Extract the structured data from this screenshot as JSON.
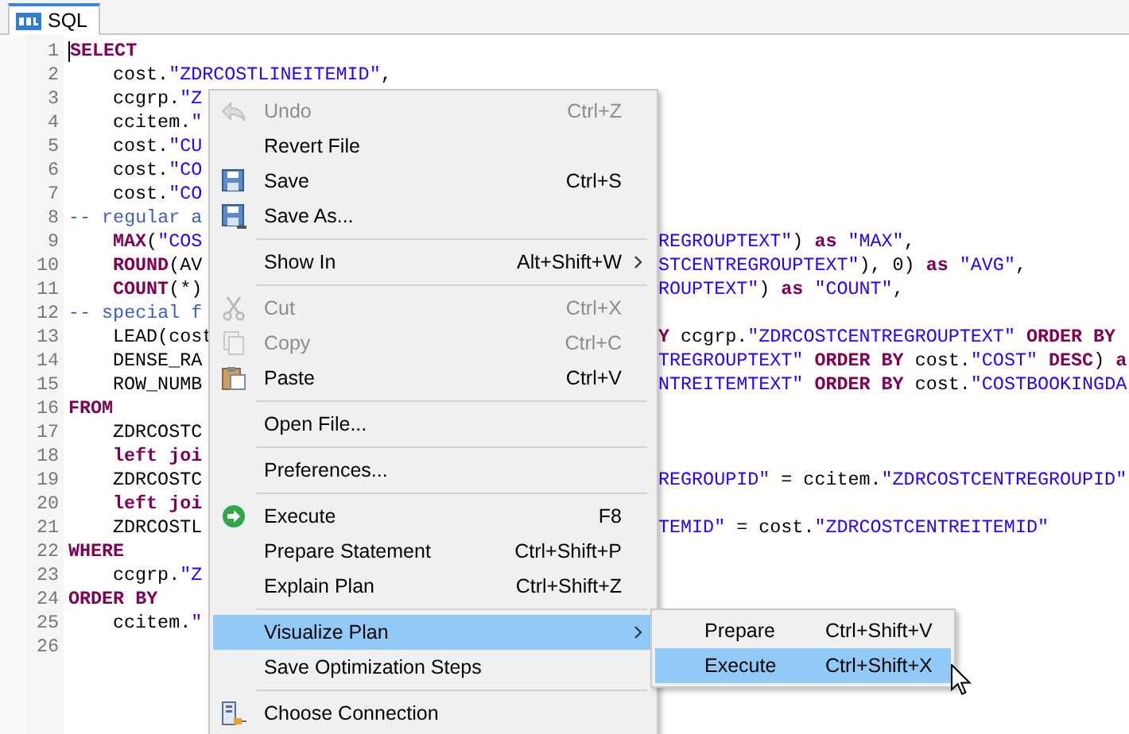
{
  "tab": {
    "label": "SQL",
    "selected": true
  },
  "lines": [
    {
      "number": "1",
      "indented": false,
      "left": [
        {
          "kind": "keyword",
          "text": "SELECT"
        }
      ]
    },
    {
      "number": "2",
      "indented": true,
      "left": [
        {
          "kind": "plain",
          "text": "cost."
        },
        {
          "kind": "string",
          "text": "\"ZDRCOSTLINEITEMID\""
        },
        {
          "kind": "plain",
          "text": ","
        }
      ]
    },
    {
      "number": "3",
      "indented": true,
      "left": [
        {
          "kind": "plain",
          "text": "ccgrp."
        },
        {
          "kind": "string",
          "text": "\"Z"
        }
      ]
    },
    {
      "number": "4",
      "indented": true,
      "left": [
        {
          "kind": "plain",
          "text": "ccitem."
        },
        {
          "kind": "string",
          "text": "\""
        }
      ]
    },
    {
      "number": "5",
      "indented": true,
      "left": [
        {
          "kind": "plain",
          "text": "cost."
        },
        {
          "kind": "string",
          "text": "\"CU"
        }
      ]
    },
    {
      "number": "6",
      "indented": true,
      "left": [
        {
          "kind": "plain",
          "text": "cost."
        },
        {
          "kind": "string",
          "text": "\"CO"
        }
      ]
    },
    {
      "number": "7",
      "indented": true,
      "left": [
        {
          "kind": "plain",
          "text": "cost."
        },
        {
          "kind": "string",
          "text": "\"CO"
        }
      ]
    },
    {
      "number": "8",
      "indented": false,
      "left": [
        {
          "kind": "comment",
          "text": "-- regular a"
        }
      ]
    },
    {
      "number": "9",
      "indented": true,
      "left": [
        {
          "kind": "keyword",
          "text": "MAX"
        },
        {
          "kind": "plain",
          "text": "("
        },
        {
          "kind": "string",
          "text": "\"COS"
        }
      ],
      "right": [
        {
          "kind": "string",
          "text": "REGROUPTEXT\""
        },
        {
          "kind": "plain",
          "text": ") "
        },
        {
          "kind": "keyword",
          "text": "as "
        },
        {
          "kind": "string",
          "text": "\"MAX\""
        },
        {
          "kind": "plain",
          "text": ","
        }
      ]
    },
    {
      "number": "10",
      "indented": true,
      "left": [
        {
          "kind": "keyword",
          "text": "ROUND"
        },
        {
          "kind": "plain",
          "text": "(AV"
        }
      ],
      "right": [
        {
          "kind": "string",
          "text": "STCENTREGROUPTEXT\""
        },
        {
          "kind": "plain",
          "text": "), 0) "
        },
        {
          "kind": "keyword",
          "text": "as "
        },
        {
          "kind": "string",
          "text": "\"AVG\""
        },
        {
          "kind": "plain",
          "text": ","
        }
      ]
    },
    {
      "number": "11",
      "indented": true,
      "left": [
        {
          "kind": "keyword",
          "text": "COUNT"
        },
        {
          "kind": "plain",
          "text": "(*)"
        }
      ],
      "right": [
        {
          "kind": "string",
          "text": "ROUPTEXT\""
        },
        {
          "kind": "plain",
          "text": ") "
        },
        {
          "kind": "keyword",
          "text": "as "
        },
        {
          "kind": "string",
          "text": "\"COUNT\""
        },
        {
          "kind": "plain",
          "text": ","
        }
      ]
    },
    {
      "number": "12",
      "indented": false,
      "left": [
        {
          "kind": "comment",
          "text": "-- special f"
        }
      ]
    },
    {
      "number": "13",
      "indented": true,
      "left": [
        {
          "kind": "plain",
          "text": "LEAD(cost"
        }
      ],
      "right": [
        {
          "kind": "keyword",
          "text": "Y"
        },
        {
          "kind": "plain",
          "text": " ccgrp."
        },
        {
          "kind": "string",
          "text": "\"ZDRCOSTCENTREGROUPTEXT\""
        },
        {
          "kind": "keyword",
          "text": " ORDER BY"
        }
      ]
    },
    {
      "number": "14",
      "indented": true,
      "left": [
        {
          "kind": "plain",
          "text": "DENSE_RA"
        }
      ],
      "right": [
        {
          "kind": "string",
          "text": "TREGROUPTEXT\""
        },
        {
          "kind": "keyword",
          "text": " ORDER BY"
        },
        {
          "kind": "plain",
          "text": " cost."
        },
        {
          "kind": "string",
          "text": "\"COST\""
        },
        {
          "kind": "keyword",
          "text": " DESC"
        },
        {
          "kind": "plain",
          "text": ") "
        },
        {
          "kind": "keyword",
          "text": "a"
        }
      ]
    },
    {
      "number": "15",
      "indented": true,
      "left": [
        {
          "kind": "plain",
          "text": "ROW_NUMB"
        }
      ],
      "right": [
        {
          "kind": "string",
          "text": "NTREITEMTEXT\""
        },
        {
          "kind": "keyword",
          "text": " ORDER BY"
        },
        {
          "kind": "plain",
          "text": " cost."
        },
        {
          "kind": "string",
          "text": "\"COSTBOOKINGDA"
        }
      ]
    },
    {
      "number": "16",
      "indented": false,
      "left": [
        {
          "kind": "keyword",
          "text": "FROM"
        }
      ]
    },
    {
      "number": "17",
      "indented": true,
      "left": [
        {
          "kind": "plain",
          "text": "ZDRCOSTC"
        }
      ]
    },
    {
      "number": "18",
      "indented": true,
      "left": [
        {
          "kind": "keyword",
          "text": "left joi"
        }
      ]
    },
    {
      "number": "19",
      "indented": true,
      "left": [
        {
          "kind": "plain",
          "text": "ZDRCOSTC"
        }
      ],
      "right": [
        {
          "kind": "string",
          "text": "REGROUPID\""
        },
        {
          "kind": "plain",
          "text": " = ccitem."
        },
        {
          "kind": "string",
          "text": "\"ZDRCOSTCENTREGROUPID\""
        }
      ]
    },
    {
      "number": "20",
      "indented": true,
      "left": [
        {
          "kind": "keyword",
          "text": "left joi"
        }
      ]
    },
    {
      "number": "21",
      "indented": true,
      "left": [
        {
          "kind": "plain",
          "text": "ZDRCOSTL"
        }
      ],
      "right": [
        {
          "kind": "string",
          "text": "TEMID\""
        },
        {
          "kind": "plain",
          "text": " = cost."
        },
        {
          "kind": "string",
          "text": "\"ZDRCOSTCENTREITEMID\""
        }
      ]
    },
    {
      "number": "22",
      "indented": false,
      "left": [
        {
          "kind": "keyword",
          "text": "WHERE"
        }
      ]
    },
    {
      "number": "23",
      "indented": true,
      "left": [
        {
          "kind": "plain",
          "text": "ccgrp."
        },
        {
          "kind": "string",
          "text": "\"Z"
        }
      ]
    },
    {
      "number": "24",
      "indented": false,
      "left": [
        {
          "kind": "keyword",
          "text": "ORDER BY"
        }
      ]
    },
    {
      "number": "25",
      "indented": true,
      "left": [
        {
          "kind": "plain",
          "text": "ccitem."
        },
        {
          "kind": "string",
          "text": "\""
        }
      ]
    },
    {
      "number": "26"
    }
  ],
  "context_menu": {
    "items": [
      {
        "kind": "item",
        "label": "Undo",
        "shortcut": "Ctrl+Z",
        "disabled": true,
        "selected": false,
        "has_submenu": false
      },
      {
        "kind": "item",
        "label": "Revert File",
        "disabled": false,
        "selected": false,
        "has_submenu": false
      },
      {
        "kind": "item",
        "label": "Save",
        "shortcut": "Ctrl+S",
        "disabled": false,
        "selected": false,
        "has_submenu": false
      },
      {
        "kind": "item",
        "label": "Save As...",
        "disabled": false,
        "selected": false,
        "has_submenu": false
      },
      {
        "kind": "separator"
      },
      {
        "kind": "item",
        "label": "Show In",
        "shortcut": "Alt+Shift+W",
        "disabled": false,
        "selected": false,
        "has_submenu": true
      },
      {
        "kind": "separator"
      },
      {
        "kind": "item",
        "label": "Cut",
        "shortcut": "Ctrl+X",
        "disabled": true,
        "selected": false,
        "has_submenu": false
      },
      {
        "kind": "item",
        "label": "Copy",
        "shortcut": "Ctrl+C",
        "disabled": true,
        "selected": false,
        "has_submenu": false
      },
      {
        "kind": "item",
        "label": "Paste",
        "shortcut": "Ctrl+V",
        "disabled": false,
        "selected": false,
        "has_submenu": false
      },
      {
        "kind": "separator"
      },
      {
        "kind": "item",
        "label": "Open File...",
        "disabled": false,
        "selected": false,
        "has_submenu": false
      },
      {
        "kind": "separator"
      },
      {
        "kind": "item",
        "label": "Preferences...",
        "disabled": false,
        "selected": false,
        "has_submenu": false
      },
      {
        "kind": "separator"
      },
      {
        "kind": "item",
        "label": "Execute",
        "shortcut": "F8",
        "disabled": false,
        "selected": false,
        "has_submenu": false
      },
      {
        "kind": "item",
        "label": "Prepare Statement",
        "shortcut": "Ctrl+Shift+P",
        "disabled": false,
        "selected": false,
        "has_submenu": false
      },
      {
        "kind": "item",
        "label": "Explain Plan",
        "shortcut": "Ctrl+Shift+Z",
        "disabled": false,
        "selected": false,
        "has_submenu": false
      },
      {
        "kind": "separator"
      },
      {
        "kind": "item",
        "label": "Visualize Plan",
        "disabled": false,
        "selected": true,
        "has_submenu": true
      },
      {
        "kind": "item",
        "label": "Save Optimization Steps",
        "disabled": false,
        "selected": false,
        "has_submenu": false
      },
      {
        "kind": "separator"
      },
      {
        "kind": "item",
        "label": "Choose Connection",
        "disabled": false,
        "selected": false,
        "has_submenu": false
      }
    ]
  },
  "submenu": {
    "items": [
      {
        "label": "Prepare",
        "shortcut": "Ctrl+Shift+V",
        "selected": false
      },
      {
        "label": "Execute",
        "shortcut": "Ctrl+Shift+X",
        "selected": true
      }
    ]
  }
}
